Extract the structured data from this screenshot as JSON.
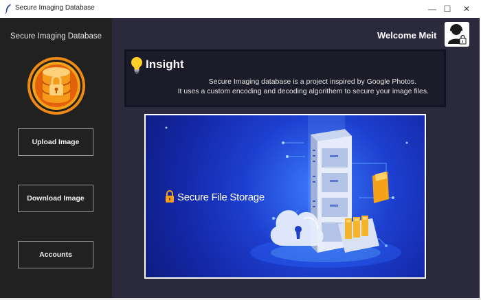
{
  "window": {
    "title": "Secure Imaging Database",
    "controls": {
      "minimize": "—",
      "maximize": "☐",
      "close": "✕"
    }
  },
  "sidebar": {
    "brand": "Secure Imaging Database",
    "buttons": [
      "Upload Image",
      "Download Image",
      "Accounts"
    ]
  },
  "header": {
    "welcome": "Welcome Meit"
  },
  "insight": {
    "title": "Insight",
    "line1": "Secure Imaging database is a project inspired by Google Photos.",
    "line2": "It uses a custom encoding and decoding algorithem to secure your image files."
  },
  "banner": {
    "text": "Secure File Storage"
  },
  "icons": {
    "app": "feather-icon",
    "logo": "database-lock-icon",
    "avatar": "user-lock-icon",
    "bulb": "lightbulb-icon"
  },
  "colors": {
    "sidebar": "#212121",
    "main": "#2b2a3d",
    "accent": "#f4a21a",
    "banner": "#1d3fcf"
  }
}
